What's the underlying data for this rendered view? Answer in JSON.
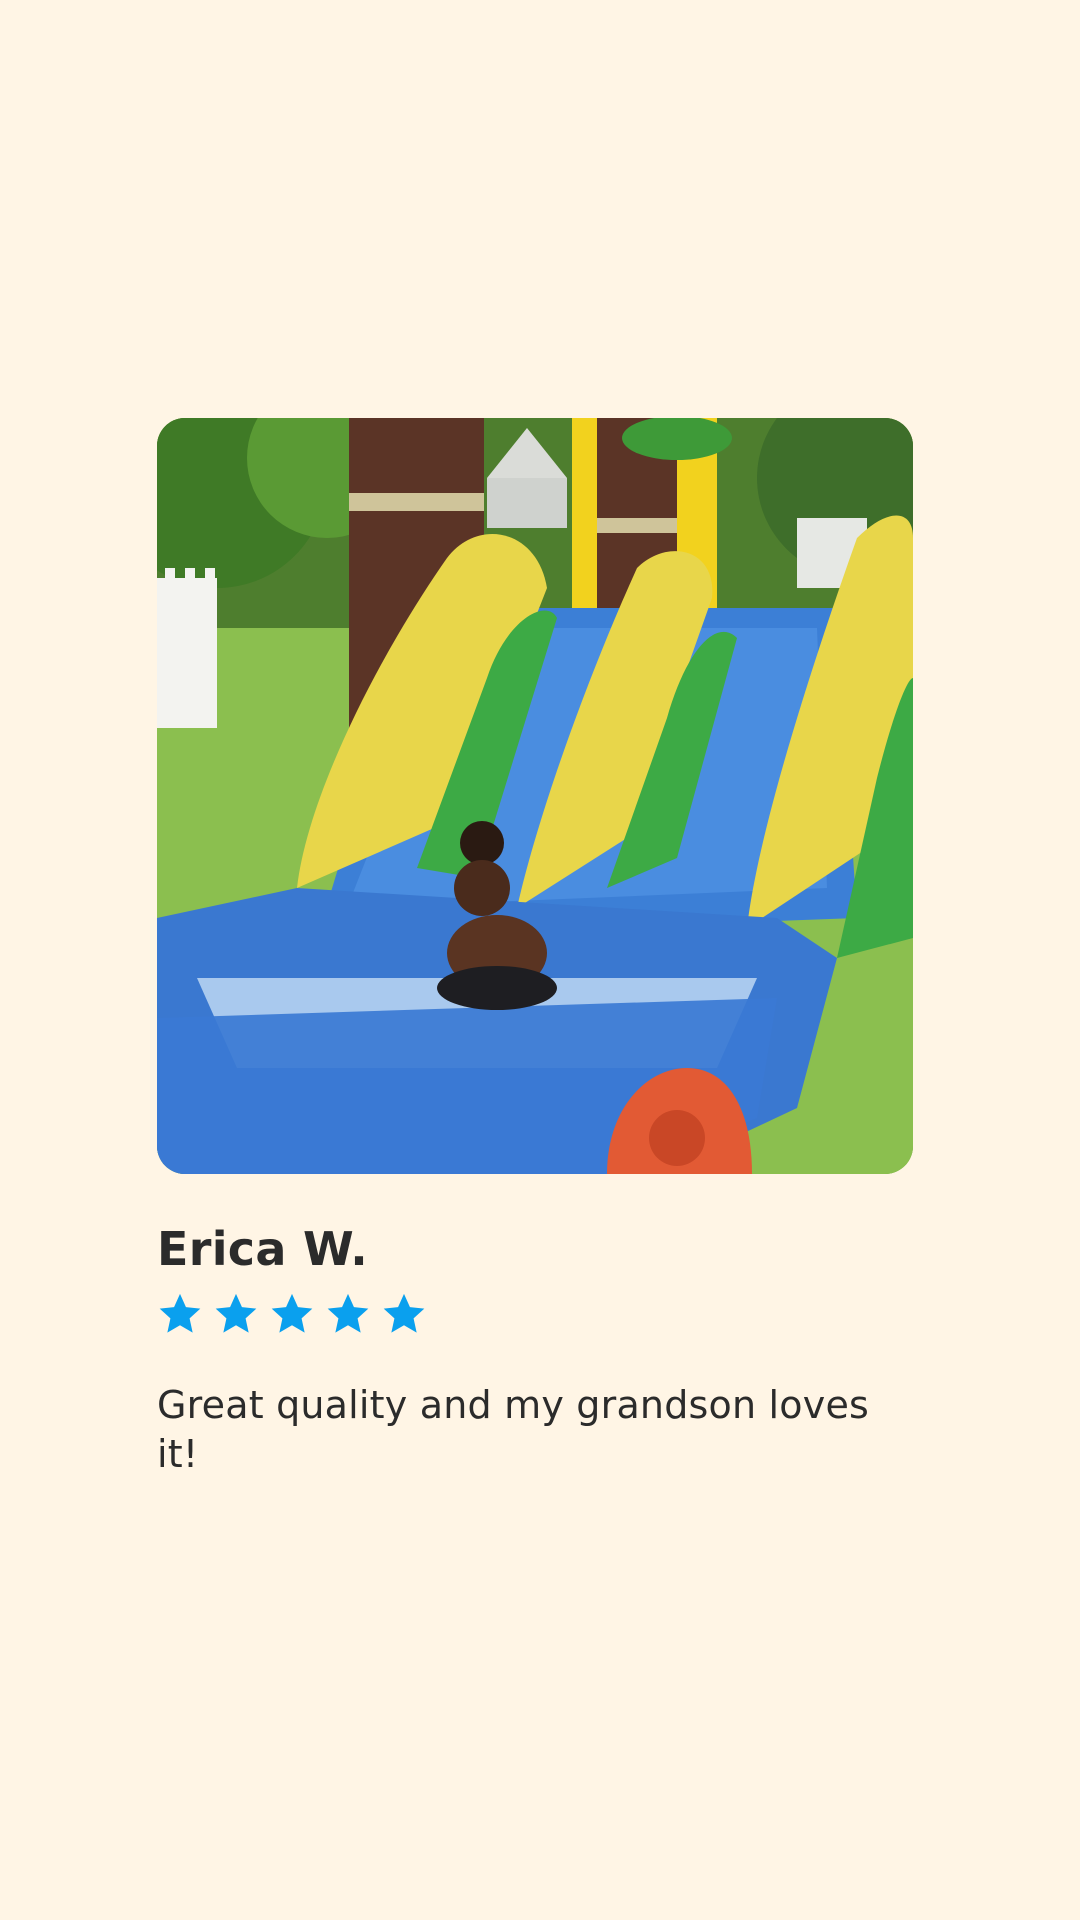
{
  "review": {
    "name": "Erica W.",
    "rating": 5,
    "max_rating": 5,
    "text": "Great quality and my grandson loves it!",
    "photo_icon": "photo-inflatable-water-slide",
    "star_icon": "star-icon"
  },
  "colors": {
    "background": "#FFF5E5",
    "star": "#0AA0EE",
    "text": "#2B2B2B"
  }
}
